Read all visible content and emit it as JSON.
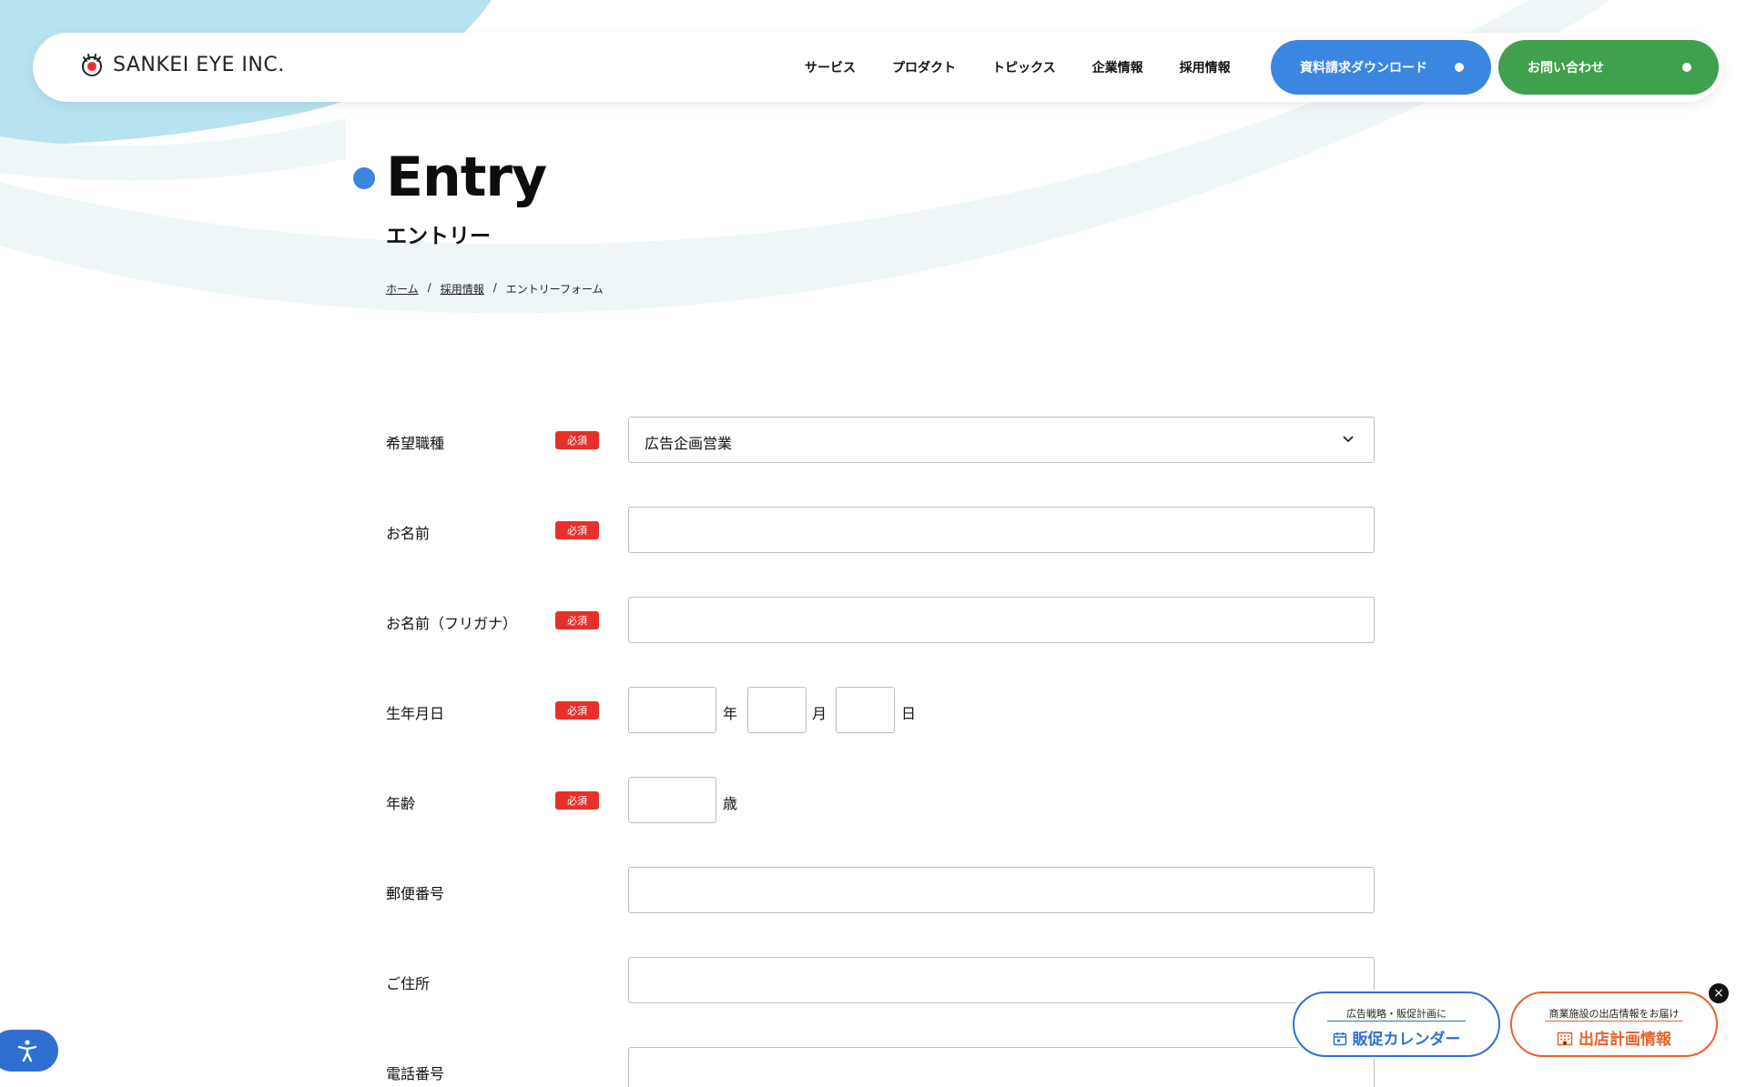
{
  "header": {
    "logo_text": "SANKEI EYE INC.",
    "nav": [
      "サービス",
      "プロダクト",
      "トピックス",
      "企業情報",
      "採用情報"
    ],
    "cta_download": "資料請求ダウンロード",
    "cta_contact": "お問い合わせ"
  },
  "page": {
    "title_en": "Entry",
    "title_ja": "エントリー",
    "breadcrumb": [
      "ホーム",
      "採用情報",
      "エントリーフォーム"
    ],
    "breadcrumb_sep": "/"
  },
  "form": {
    "required_label": "必須",
    "job_label": "希望職種",
    "job_selected": "広告企画営業",
    "name_label": "お名前",
    "kana_label": "お名前（フリガナ）",
    "birth_label": "生年月日",
    "birth_year_unit": "年",
    "birth_month_unit": "月",
    "birth_day_unit": "日",
    "age_label": "年齢",
    "age_unit": "歳",
    "zip_label": "郵便番号",
    "address_label": "ご住所",
    "phone_label": "電話番号"
  },
  "banners": {
    "calendar_sub": "広告戦略・販促計画に",
    "calendar_main": "販促カレンダー",
    "shop_sub": "商業施設の出店情報をお届け",
    "shop_main": "出店計画情報",
    "close": "×"
  },
  "colors": {
    "blue": "#3b86e0",
    "green": "#3fa04e",
    "required_red": "#e8302b",
    "orange": "#e8622b"
  }
}
